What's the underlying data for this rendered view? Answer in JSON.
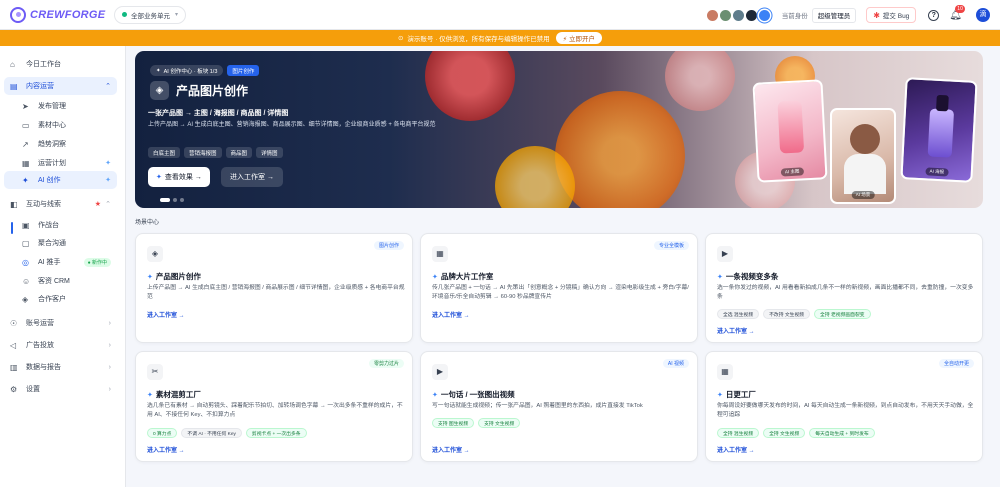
{
  "app": {
    "brand": "CREWFORGE"
  },
  "header": {
    "business_select": "全部业务单元",
    "theme_colors": [
      "#c97b63",
      "#6b8f71",
      "#5f7d8c",
      "#1f2937",
      "#3b82f6"
    ],
    "role_label": "当前身份",
    "role_value": "超级管理员",
    "bug_label": "提交 Bug",
    "notif_count": "10",
    "avatar_text": "滴"
  },
  "notice": {
    "text": "演示账号 · 仅供浏览，所有保存与编辑操作已禁用",
    "button": "立即开户"
  },
  "sidebar": {
    "workbench": "今日工作台",
    "content_ops": "内容运营",
    "publish": "发布管理",
    "materials": "素材中心",
    "trends": "趋势洞察",
    "plan": "运营计划",
    "ai_create": "AI 创作",
    "interaction": "互动与线索",
    "workbench2": "作战台",
    "chat": "聚合沟通",
    "ai_assistant": "AI 推手",
    "ai_assistant_badge": "● 新作中",
    "crm": "客资 CRM",
    "partners": "合作客户",
    "accounts": "账号运营",
    "ads": "广告投放",
    "reports": "数据与报告",
    "settings": "设置"
  },
  "hero": {
    "tag": "AI 创作中心 · 板块 1/3",
    "tag2": "图片创作",
    "title": "产品图片创作",
    "subtitle": "一张产品图 → 主图 / 海报图 / 商品图 / 详情图",
    "desc": "上传产品图 → AI 生成白底主图、营销海报图、商品展示图、细节详情图，企业级商业质感 + 各电商平台规范",
    "chips": [
      "白底主图",
      "营销海报图",
      "商品图",
      "详情图"
    ],
    "btn_view": "查看效果 →",
    "btn_enter": "进入工作室 →",
    "thumbs": [
      "AI 主图",
      "AI 场景",
      "AI 海报"
    ]
  },
  "section_label": "场景中心",
  "cards": [
    {
      "badge": "图片创作",
      "title": "产品图片创作",
      "desc": "上传产品图 → AI 生成白底主图 / 营销海报图 / 商品展示图 / 细节详情图，企业级质感 + 各电商平台规范",
      "tags": [],
      "link": "进入工作室 →"
    },
    {
      "badge": "专业全模板",
      "title": "品牌大片工作室",
      "desc": "传几张产品图 + 一句话 → AI 先策出「创意概念 + 分镜稿」确认方向 → 渲染电影级生成 + 旁白/字幕/环境音乐/乐全自动剪辑 → 60-90 秒品牌宣传片",
      "tags": [],
      "link": "进入工作室 →"
    },
    {
      "badge": "",
      "title": "一条视频变多条",
      "desc": "选一条你发过的视频，AI 用看看新拍成几条不一样的新视频，画面比播都不同，去重防撞，一次变多条",
      "tags": [
        {
          "t": "全选 混生视频",
          "g": false
        },
        {
          "t": "不改持 文生视频",
          "g": false
        },
        {
          "t": "全持 老视频画面裂变",
          "g": true
        }
      ],
      "link": "进入工作室 →"
    },
    {
      "badge": "零剪力过片",
      "title": "素材混剪工厂",
      "desc": "选几条已有素材 → 自动剪镜头、踩着配乐节拍切、加转场调色字幕 → 一次出多条不重样的成片，不用 AI、不接任何 Key、不扣算力点",
      "tags": [
        {
          "t": "0 算力点",
          "g": true
        },
        {
          "t": "不调 AI · 不用任何 Key",
          "g": false
        },
        {
          "t": "剪视卡点 + 一次出多条",
          "g": true
        }
      ],
      "link": "进入工作室 →"
    },
    {
      "badge": "AI 视频",
      "title": "一句话 / 一张图出视频",
      "desc": "写一句话就能生成视频；传一张产品图，AI 照着图里的东西拍，成片直接发 TikTok",
      "tags": [
        {
          "t": "支持 图生视频",
          "g": true
        },
        {
          "t": "支持 文生视频",
          "g": true
        }
      ],
      "link": "进入工作室 →"
    },
    {
      "badge": "全自动开更",
      "title": "日更工厂",
      "desc": "你每周设好要做哪天发布的时间，AI 每天自动生成一条新视频，到点自动发布，不用天天手动做，全程可追踪",
      "tags": [
        {
          "t": "全持 混生视频",
          "g": true
        },
        {
          "t": "全持 文生视频",
          "g": true
        },
        {
          "t": "每天自动生成 + 到时发布",
          "g": true
        }
      ],
      "link": "进入工作室 →"
    }
  ]
}
